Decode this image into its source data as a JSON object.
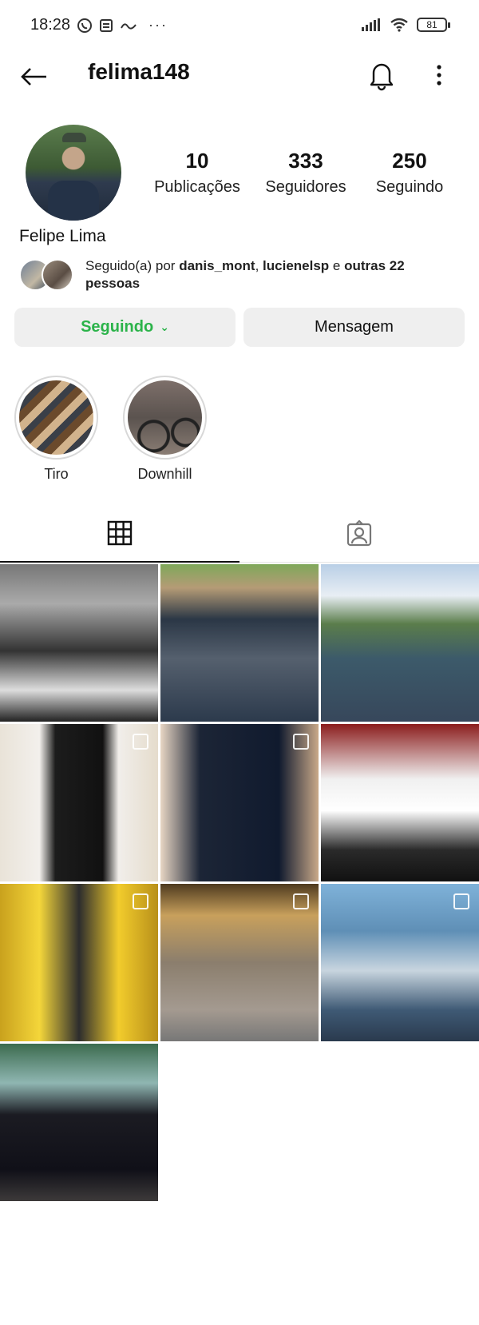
{
  "status_bar": {
    "time": "18:28",
    "battery": "81",
    "more_dots": "···"
  },
  "header": {
    "username": "felima148"
  },
  "profile": {
    "full_name": "Felipe Lima",
    "stats": {
      "posts_count": "10",
      "posts_label": "Publicações",
      "followers_count": "333",
      "followers_label": "Seguidores",
      "following_count": "250",
      "following_label": "Seguindo"
    },
    "followed_by": {
      "prefix": "Seguido(a) por ",
      "user1": "danis_mont",
      "sep": ", ",
      "user2": "lucienelsp",
      "connector": " e ",
      "others": "outras 22 pessoas"
    },
    "buttons": {
      "following_label": "Seguindo",
      "chevron": "⌄",
      "message_label": "Mensagem"
    }
  },
  "highlights": [
    {
      "label": "Tiro"
    },
    {
      "label": "Downhill"
    }
  ],
  "tabs": {
    "active": "grid",
    "items": [
      "grid-icon",
      "tagged-icon"
    ]
  },
  "posts": [
    {
      "multi": false
    },
    {
      "multi": false
    },
    {
      "multi": false
    },
    {
      "multi": true
    },
    {
      "multi": true
    },
    {
      "multi": false
    },
    {
      "multi": true
    },
    {
      "multi": true
    },
    {
      "multi": true
    },
    {
      "multi": false
    }
  ],
  "colors": {
    "following_accent": "#2bb34a",
    "button_bg": "#efefef"
  }
}
